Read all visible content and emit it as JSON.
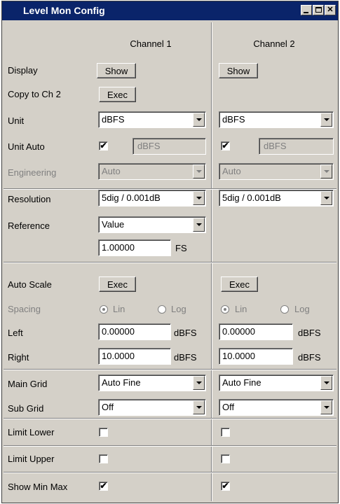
{
  "window": {
    "title": "Level Mon Config",
    "controls": {
      "minimize": "minimize-icon",
      "maximize": "maximize-icon",
      "close": "close-icon"
    }
  },
  "columns": {
    "ch1": "Channel 1",
    "ch2": "Channel 2"
  },
  "display": {
    "label": "Display",
    "ch1_button": "Show",
    "ch2_button": "Show"
  },
  "copy": {
    "label": "Copy to Ch 2",
    "button": "Exec"
  },
  "unit": {
    "label": "Unit",
    "ch1": "dBFS",
    "ch2": "dBFS"
  },
  "unit_auto": {
    "label": "Unit Auto",
    "ch1_checked": true,
    "ch1_value": "dBFS",
    "ch2_checked": true,
    "ch2_value": "dBFS",
    "check_mark": "✔"
  },
  "engineering": {
    "label": "Engineering",
    "ch1": "Auto",
    "ch2": "Auto"
  },
  "resolution": {
    "label": "Resolution",
    "ch1": "5dig / 0.001dB",
    "ch2": "5dig / 0.001dB"
  },
  "reference": {
    "label": "Reference",
    "mode": "Value",
    "value": "1.00000",
    "unit": "FS"
  },
  "auto_scale": {
    "label": "Auto Scale",
    "ch1_button": "Exec",
    "ch2_button": "Exec"
  },
  "spacing": {
    "label": "Spacing",
    "lin": "Lin",
    "log": "Log",
    "ch1_selected": "Lin",
    "ch2_selected": "Lin"
  },
  "left": {
    "label": "Left",
    "ch1": "0.00000",
    "ch2": "0.00000",
    "unit": "dBFS"
  },
  "right": {
    "label": "Right",
    "ch1": "10.0000",
    "ch2": "10.0000",
    "unit": "dBFS"
  },
  "main_grid": {
    "label": "Main Grid",
    "ch1": "Auto Fine",
    "ch2": "Auto Fine"
  },
  "sub_grid": {
    "label": "Sub Grid",
    "ch1": "Off",
    "ch2": "Off"
  },
  "limit_lower": {
    "label": "Limit Lower",
    "ch1_checked": false,
    "ch2_checked": false
  },
  "limit_upper": {
    "label": "Limit Upper",
    "ch1_checked": false,
    "ch2_checked": false
  },
  "show_min_max": {
    "label": "Show Min Max",
    "ch1_checked": true,
    "ch2_checked": true,
    "check_mark": "✔"
  }
}
